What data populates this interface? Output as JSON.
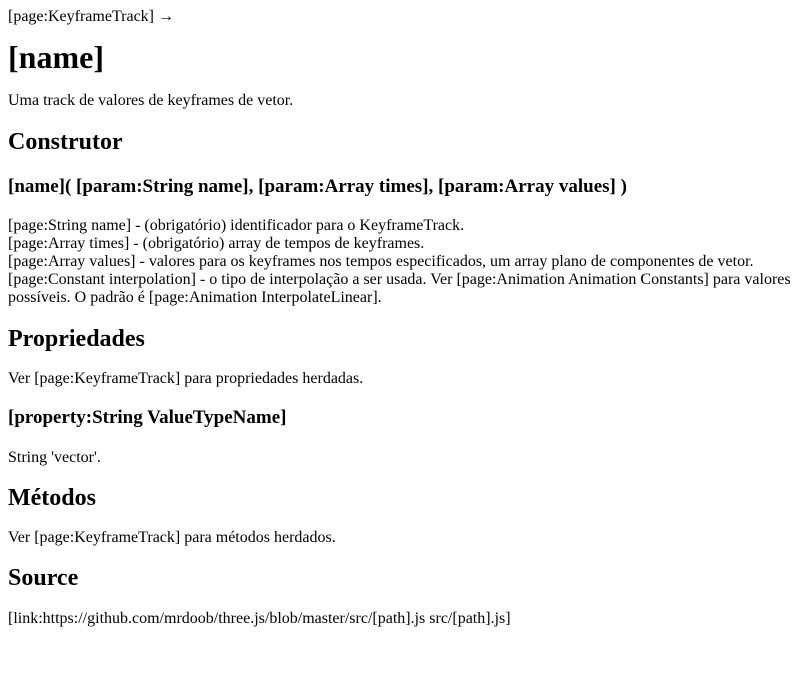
{
  "breadcrumb": "[page:KeyframeTrack] →",
  "title": "[name]",
  "description": "Uma track de valores de keyframes de vetor.",
  "constructor": {
    "heading": "Construtor",
    "signature": "[name]( [param:String name], [param:Array times], [param:Array values] )",
    "params": [
      "[page:String name] - (obrigatório) identificador para o KeyframeTrack.",
      "[page:Array times] - (obrigatório) array de tempos de keyframes.",
      "[page:Array values] - valores para os keyframes nos tempos especificados, um array plano de componentes de vetor.",
      "[page:Constant interpolation] - o tipo de interpolação a ser usada. Ver [page:Animation Animation Constants] para valores possíveis. O padrão é [page:Animation InterpolateLinear]."
    ]
  },
  "properties": {
    "heading": "Propriedades",
    "text": "Ver [page:KeyframeTrack] para propriedades herdadas.",
    "property_name": "[property:String ValueTypeName]",
    "property_value": "String 'vector'."
  },
  "methods": {
    "heading": "Métodos",
    "text": "Ver [page:KeyframeTrack] para métodos herdados."
  },
  "source": {
    "heading": "Source",
    "text": "[link:https://github.com/mrdoob/three.js/blob/master/src/[path].js src/[path].js]"
  }
}
